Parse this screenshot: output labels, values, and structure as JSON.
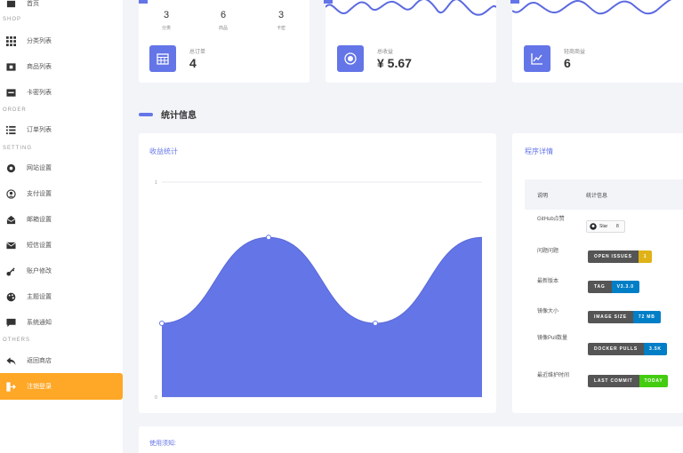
{
  "sidebar": {
    "home": "首页",
    "section_shop": "SHOP",
    "category_list": "分类列表",
    "product_list": "商品列表",
    "card_list": "卡密列表",
    "section_order": "ORDER",
    "order_list": "订单列表",
    "section_setting": "SETTING",
    "site_settings": "网站设置",
    "payment_settings": "支付设置",
    "email_settings": "邮箱设置",
    "sms_settings": "短信设置",
    "account_edit": "账户修改",
    "theme_settings": "主题设置",
    "notice": "系统通知",
    "section_others": "OTHERS",
    "back_to_store": "返回商店",
    "logout": "注销登录"
  },
  "cards": {
    "card1_stats": [
      {
        "value": "3",
        "label": "分类"
      },
      {
        "value": "6",
        "label": "商品"
      },
      {
        "value": "3",
        "label": "卡密"
      }
    ],
    "card1_label": "总订单",
    "card1_value": "4",
    "card2_label": "总收益",
    "card2_value": "¥ 5.67",
    "card3_label": "轻商商益",
    "card3_value": "6"
  },
  "section_title": "统计信息",
  "revenue_chart_title": "收益统计",
  "details_title": "程序详情",
  "details_table": {
    "col1": "说明",
    "col2": "统计信息",
    "rows": [
      {
        "label": "GitHub点赞"
      },
      {
        "label": "问题问题",
        "badge_k": "OPEN ISSUES",
        "badge_v": "1",
        "color": "#dfb317"
      },
      {
        "label": "最新版本",
        "badge_k": "TAG",
        "badge_v": "V3.3.0",
        "color": "#007ec6"
      },
      {
        "label": "镜像大小",
        "badge_k": "IMAGE SIZE",
        "badge_v": "72 MB",
        "color": "#007ec6"
      },
      {
        "label": "镜像Pull数量",
        "badge_k": "DOCKER PULLS",
        "badge_v": "3.5K",
        "color": "#007ec6"
      },
      {
        "label": "最近维护时间",
        "badge_k": "LAST COMMIT",
        "badge_v": "TODAY",
        "color": "#4c1"
      }
    ],
    "github_star": "Star",
    "github_count": "8"
  },
  "bottom_title": "使用须知:",
  "colors": {
    "accent": "#6475e8",
    "active": "#ffa726"
  },
  "chart_data": {
    "type": "area",
    "x": [
      0,
      1,
      2,
      3
    ],
    "values": [
      1.2,
      2.6,
      1.2,
      2.6
    ],
    "ytick_labels": [
      "0",
      "1"
    ],
    "series_color": "#6475e8",
    "grid": true
  }
}
